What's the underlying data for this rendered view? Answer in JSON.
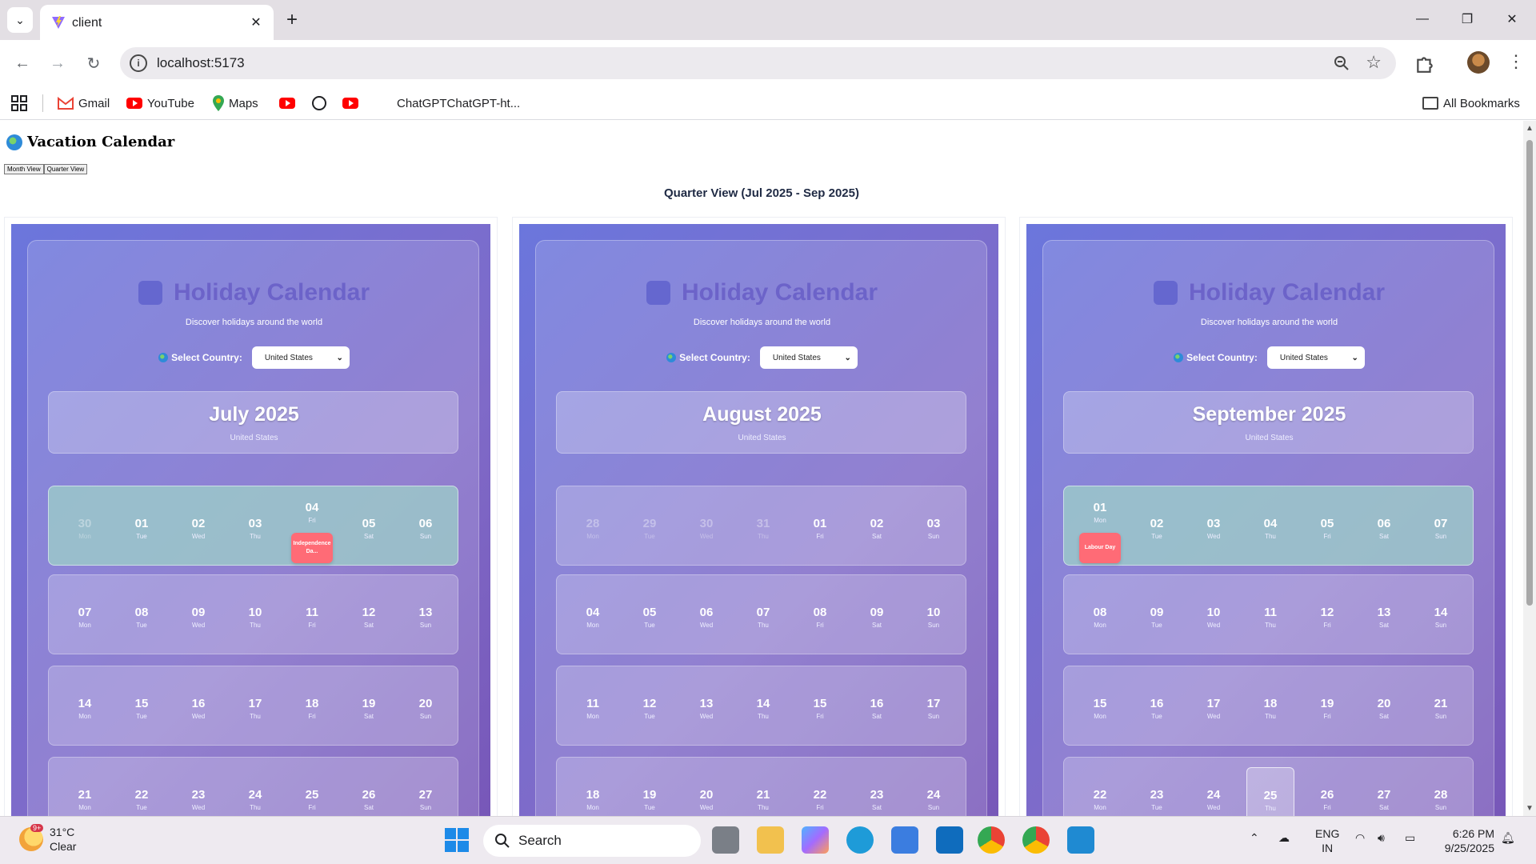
{
  "browser": {
    "tab_title": "client",
    "url": "localhost:5173",
    "bookmarks": {
      "gmail": "Gmail",
      "youtube": "YouTube",
      "maps": "Maps",
      "chatgpt": "ChatGPTChatGPT-ht...",
      "all": "All Bookmarks"
    }
  },
  "app": {
    "title": "Vacation Calendar",
    "month_view_label": "Month View",
    "quarter_view_label": "Quarter View",
    "quarter_title": "Quarter View (Jul 2025 - Sep 2025)"
  },
  "card_common": {
    "title": "Holiday Calendar",
    "subtitle": "Discover holidays around the world",
    "country_label": "Select Country:",
    "country_value": "United States"
  },
  "months": [
    {
      "name": "July 2025",
      "country": "United States",
      "weeks": [
        {
          "holiday": true,
          "days": [
            {
              "n": "30",
              "d": "Mon",
              "dim": true
            },
            {
              "n": "01",
              "d": "Tue"
            },
            {
              "n": "02",
              "d": "Wed"
            },
            {
              "n": "03",
              "d": "Thu"
            },
            {
              "n": "04",
              "d": "Fri",
              "holiday": "Independence Da..."
            },
            {
              "n": "05",
              "d": "Sat"
            },
            {
              "n": "06",
              "d": "Sun"
            }
          ]
        },
        {
          "days": [
            {
              "n": "07",
              "d": "Mon"
            },
            {
              "n": "08",
              "d": "Tue"
            },
            {
              "n": "09",
              "d": "Wed"
            },
            {
              "n": "10",
              "d": "Thu"
            },
            {
              "n": "11",
              "d": "Fri"
            },
            {
              "n": "12",
              "d": "Sat"
            },
            {
              "n": "13",
              "d": "Sun"
            }
          ]
        },
        {
          "days": [
            {
              "n": "14",
              "d": "Mon"
            },
            {
              "n": "15",
              "d": "Tue"
            },
            {
              "n": "16",
              "d": "Wed"
            },
            {
              "n": "17",
              "d": "Thu"
            },
            {
              "n": "18",
              "d": "Fri"
            },
            {
              "n": "19",
              "d": "Sat"
            },
            {
              "n": "20",
              "d": "Sun"
            }
          ]
        },
        {
          "days": [
            {
              "n": "21",
              "d": "Mon"
            },
            {
              "n": "22",
              "d": "Tue"
            },
            {
              "n": "23",
              "d": "Wed"
            },
            {
              "n": "24",
              "d": "Thu"
            },
            {
              "n": "25",
              "d": "Fri"
            },
            {
              "n": "26",
              "d": "Sat"
            },
            {
              "n": "27",
              "d": "Sun"
            }
          ]
        }
      ]
    },
    {
      "name": "August 2025",
      "country": "United States",
      "weeks": [
        {
          "days": [
            {
              "n": "28",
              "d": "Mon",
              "dim": true
            },
            {
              "n": "29",
              "d": "Tue",
              "dim": true
            },
            {
              "n": "30",
              "d": "Wed",
              "dim": true
            },
            {
              "n": "31",
              "d": "Thu",
              "dim": true
            },
            {
              "n": "01",
              "d": "Fri"
            },
            {
              "n": "02",
              "d": "Sat"
            },
            {
              "n": "03",
              "d": "Sun"
            }
          ]
        },
        {
          "days": [
            {
              "n": "04",
              "d": "Mon"
            },
            {
              "n": "05",
              "d": "Tue"
            },
            {
              "n": "06",
              "d": "Wed"
            },
            {
              "n": "07",
              "d": "Thu"
            },
            {
              "n": "08",
              "d": "Fri"
            },
            {
              "n": "09",
              "d": "Sat"
            },
            {
              "n": "10",
              "d": "Sun"
            }
          ]
        },
        {
          "days": [
            {
              "n": "11",
              "d": "Mon"
            },
            {
              "n": "12",
              "d": "Tue"
            },
            {
              "n": "13",
              "d": "Wed"
            },
            {
              "n": "14",
              "d": "Thu"
            },
            {
              "n": "15",
              "d": "Fri"
            },
            {
              "n": "16",
              "d": "Sat"
            },
            {
              "n": "17",
              "d": "Sun"
            }
          ]
        },
        {
          "days": [
            {
              "n": "18",
              "d": "Mon"
            },
            {
              "n": "19",
              "d": "Tue"
            },
            {
              "n": "20",
              "d": "Wed"
            },
            {
              "n": "21",
              "d": "Thu"
            },
            {
              "n": "22",
              "d": "Fri"
            },
            {
              "n": "23",
              "d": "Sat"
            },
            {
              "n": "24",
              "d": "Sun"
            }
          ]
        }
      ]
    },
    {
      "name": "September 2025",
      "country": "United States",
      "weeks": [
        {
          "holiday": true,
          "days": [
            {
              "n": "01",
              "d": "Mon",
              "holiday": "Labour Day"
            },
            {
              "n": "02",
              "d": "Tue"
            },
            {
              "n": "03",
              "d": "Wed"
            },
            {
              "n": "04",
              "d": "Thu"
            },
            {
              "n": "05",
              "d": "Fri"
            },
            {
              "n": "06",
              "d": "Sat"
            },
            {
              "n": "07",
              "d": "Sun"
            }
          ]
        },
        {
          "days": [
            {
              "n": "08",
              "d": "Mon"
            },
            {
              "n": "09",
              "d": "Tue"
            },
            {
              "n": "10",
              "d": "Wed"
            },
            {
              "n": "11",
              "d": "Thu"
            },
            {
              "n": "12",
              "d": "Fri"
            },
            {
              "n": "13",
              "d": "Sat"
            },
            {
              "n": "14",
              "d": "Sun"
            }
          ]
        },
        {
          "days": [
            {
              "n": "15",
              "d": "Mon"
            },
            {
              "n": "16",
              "d": "Tue"
            },
            {
              "n": "17",
              "d": "Wed"
            },
            {
              "n": "18",
              "d": "Thu"
            },
            {
              "n": "19",
              "d": "Fri"
            },
            {
              "n": "20",
              "d": "Sat"
            },
            {
              "n": "21",
              "d": "Sun"
            }
          ]
        },
        {
          "days": [
            {
              "n": "22",
              "d": "Mon"
            },
            {
              "n": "23",
              "d": "Tue"
            },
            {
              "n": "24",
              "d": "Wed"
            },
            {
              "n": "25",
              "d": "Thu",
              "today": true
            },
            {
              "n": "26",
              "d": "Fri"
            },
            {
              "n": "27",
              "d": "Sat"
            },
            {
              "n": "28",
              "d": "Sun"
            }
          ]
        }
      ]
    }
  ],
  "taskbar": {
    "temp": "31°C",
    "weather": "Clear",
    "weather_badge": "9+",
    "search": "Search",
    "lang_1": "ENG",
    "lang_2": "IN",
    "time": "6:26 PM",
    "date": "9/25/2025"
  },
  "colors": {
    "calendar_gradient_start": "#6b76dc",
    "calendar_gradient_end": "#7757b8",
    "holiday_badge": "#ff6b76",
    "holiday_week": "#9ed2c8"
  }
}
